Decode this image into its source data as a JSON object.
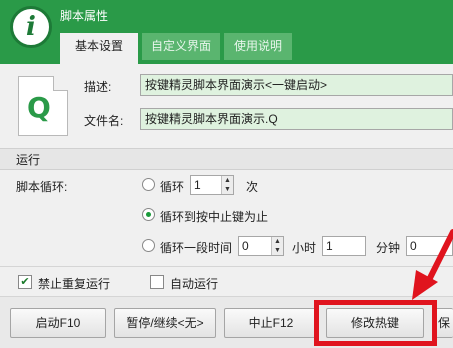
{
  "app": {
    "title": "脚本属性",
    "logo_glyph": "i"
  },
  "tabs": [
    {
      "label": "基本设置",
      "active": true
    },
    {
      "label": "自定义界面",
      "active": false
    },
    {
      "label": "使用说明",
      "active": false
    }
  ],
  "file_icon": {
    "glyph": "Q"
  },
  "fields": {
    "description_label": "描述:",
    "description_value": "按键精灵脚本界面演示<一键启动>",
    "filename_label": "文件名:",
    "filename_value": "按键精灵脚本界面演示.Q"
  },
  "run_section": {
    "title": "运行",
    "loop_label": "脚本循环:",
    "options": [
      {
        "label": "循环",
        "selected": false,
        "value": "1",
        "suffix": "次"
      },
      {
        "label": "循环到按中止键为止",
        "selected": true
      },
      {
        "label": "循环一段时间",
        "selected": false,
        "hours_value": "0",
        "hours_unit": "小时",
        "minutes_value": "1",
        "minutes_unit": "分钟",
        "seconds_value": "0"
      }
    ]
  },
  "checks": [
    {
      "label": "禁止重复运行",
      "checked": true
    },
    {
      "label": "自动运行",
      "checked": false
    }
  ],
  "buttons": {
    "start": "启动F10",
    "pause": "暂停/继续<无>",
    "stop": "中止F12",
    "hotkey": "修改热键",
    "more": "保"
  },
  "colors": {
    "header": "#2a9a48",
    "field_highlight": "#dff2df",
    "annotation_red": "#e0141e"
  },
  "icons": {
    "logo": "info-i-icon",
    "file": "q-script-file-icon",
    "spin": "up-down-arrows-icon"
  }
}
